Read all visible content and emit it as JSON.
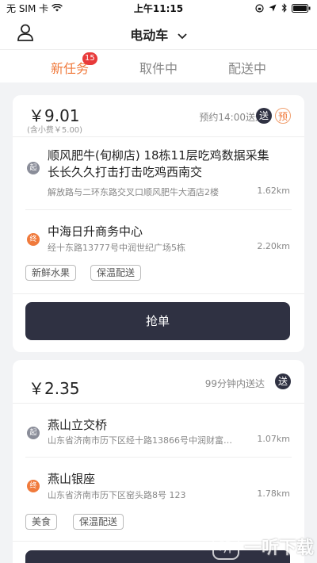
{
  "status_bar": {
    "carrier": "无 SIM 卡",
    "time": "上午11:15"
  },
  "header": {
    "title": "电动车"
  },
  "tabs": [
    {
      "label": "新任务",
      "badge": "15",
      "active": true
    },
    {
      "label": "取件中",
      "active": false
    },
    {
      "label": "配送中",
      "active": false
    }
  ],
  "orders": [
    {
      "price": "￥9.01",
      "tip": "(含小费￥5.00)",
      "deliver_time": "预约14:00送达",
      "tag_deliver": "送",
      "tag_reserve": "预",
      "pickup": {
        "marker": "起",
        "name": "顺风肥牛(旬柳店)   18栋11层吃鸡数据采集长长久久打击打击吃鸡西南交",
        "address": "解放路与二环东路交叉口顺风肥牛大酒店2楼",
        "distance": "1.62km"
      },
      "dropoff": {
        "marker": "终",
        "name": "中海日升商务中心",
        "address": "经十东路13777号中润世纪广场5栋",
        "distance": "2.20km"
      },
      "chips": [
        "新鲜水果",
        "保温配送"
      ],
      "button": "抢单"
    },
    {
      "price": "￥2.35",
      "deliver_time": "99分钟内送达",
      "tag_deliver": "送",
      "pickup": {
        "marker": "起",
        "name": "燕山立交桥",
        "address": "山东省济南市历下区经十路13866号中润财富中...",
        "distance": "1.07km"
      },
      "dropoff": {
        "marker": "终",
        "name": "燕山银座",
        "address": "山东省济南市历下区窑头路8号  123",
        "distance": "1.78km"
      },
      "chips": [
        "美食",
        "保温配送"
      ]
    }
  ],
  "watermark": "一听下载",
  "colors": {
    "accent": "#f07a3c",
    "dark_button": "#2f3142",
    "badge": "#e83a3a"
  }
}
